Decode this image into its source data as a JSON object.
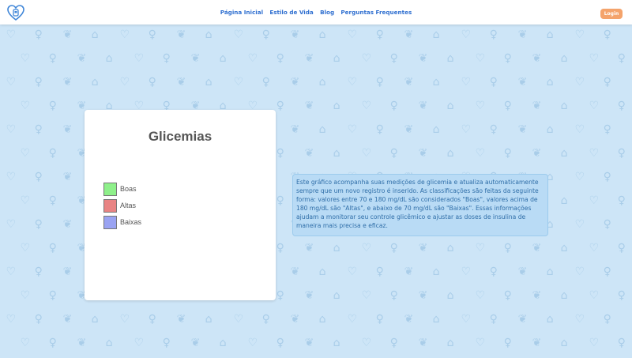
{
  "navbar": {
    "logo_icon": "heart-shield-icon",
    "links": [
      "Página Inicial",
      "Estilo de Vida",
      "Blog",
      "Perguntas Frequentes"
    ],
    "login_label": "Login",
    "login_color": "#f4a36b",
    "link_color": "#2f6fd0"
  },
  "chart_card": {
    "title": "Glicemias",
    "legend": [
      {
        "label": "Boas",
        "color": "#8ef08a"
      },
      {
        "label": "Altas",
        "color": "#e98484"
      },
      {
        "label": "Baixas",
        "color": "#9aa3f2"
      }
    ]
  },
  "chart_data": {
    "type": "pie",
    "title": "Glicemias",
    "categories": [
      "Boas",
      "Altas",
      "Baixas"
    ],
    "values": []
  },
  "info": {
    "text": "Este gráfico acompanha suas medições de glicemia e atualiza automaticamente sempre que um novo registro é inserido. As classificações são feitas da seguinte forma: valores entre 70 e 180 mg/dL são considerados \"Boas\", valores acima de 180 mg/dL são \"Altas\", e abaixo de 70 mg/dL são \"Baixas\". Essas informações ajudam a monitorar seu controle glicêmico e ajustar as doses de insulina de maneira mais precisa e eficaz."
  },
  "background": {
    "color": "#cde5f7",
    "pattern_icons": [
      "ribbon-icon",
      "heart-icon",
      "glucometer-icon",
      "syringe-icon"
    ]
  }
}
